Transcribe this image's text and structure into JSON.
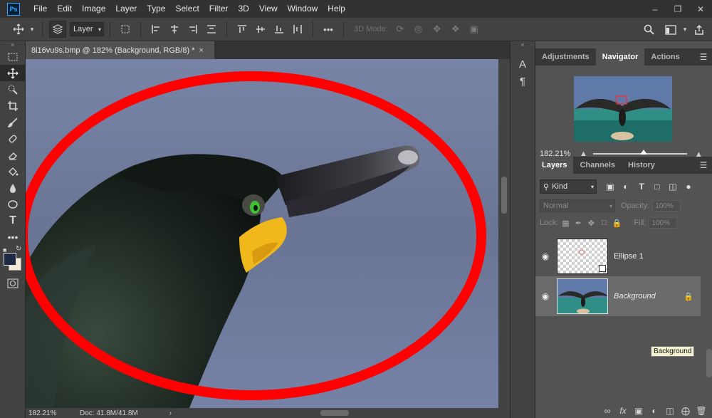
{
  "app": {
    "logo": "Ps"
  },
  "menu": [
    "File",
    "Edit",
    "Image",
    "Layer",
    "Type",
    "Select",
    "Filter",
    "3D",
    "View",
    "Window",
    "Help"
  ],
  "window_controls": {
    "minimize": "–",
    "restore": "❐",
    "close": "✕"
  },
  "options_bar": {
    "layer_select": "Layer",
    "mode_label": "3D Mode:",
    "more": "•••"
  },
  "document": {
    "tab_title": "8i16vu9s.bmp @ 182% (Background, RGB/8) *",
    "close": "×"
  },
  "status": {
    "zoom": "182.21%",
    "doc_info": "Doc: 41.8M/41.8M",
    "arrow": "›"
  },
  "panel_strip": {
    "char_icon": "A",
    "para_icon": "¶"
  },
  "nav_panel": {
    "tabs": [
      "Adjustments",
      "Navigator",
      "Actions"
    ],
    "active_tab": "Navigator",
    "zoom": "182.21%"
  },
  "layers_panel": {
    "tabs": [
      "Layers",
      "Channels",
      "History"
    ],
    "active_tab": "Layers",
    "filter_kind": "Kind",
    "blend_mode": "Normal",
    "opacity_label": "Opacity:",
    "opacity_value": "100%",
    "lock_label": "Lock:",
    "fill_label": "Fill:",
    "fill_value": "100%",
    "layers": [
      {
        "name": "Ellipse 1",
        "visible": true,
        "selected": false
      },
      {
        "name": "Background",
        "visible": true,
        "selected": true,
        "locked": true
      }
    ],
    "tooltip": "Background",
    "bottom_icons": [
      "link-icon",
      "fx-icon",
      "mask-icon",
      "adjustment-icon",
      "group-icon",
      "new-layer-icon",
      "trash-icon"
    ]
  },
  "colors": {
    "ellipse_stroke": "#ff0000",
    "accent": "#31a8ff",
    "canvas_bg": "#6e7c9c"
  }
}
